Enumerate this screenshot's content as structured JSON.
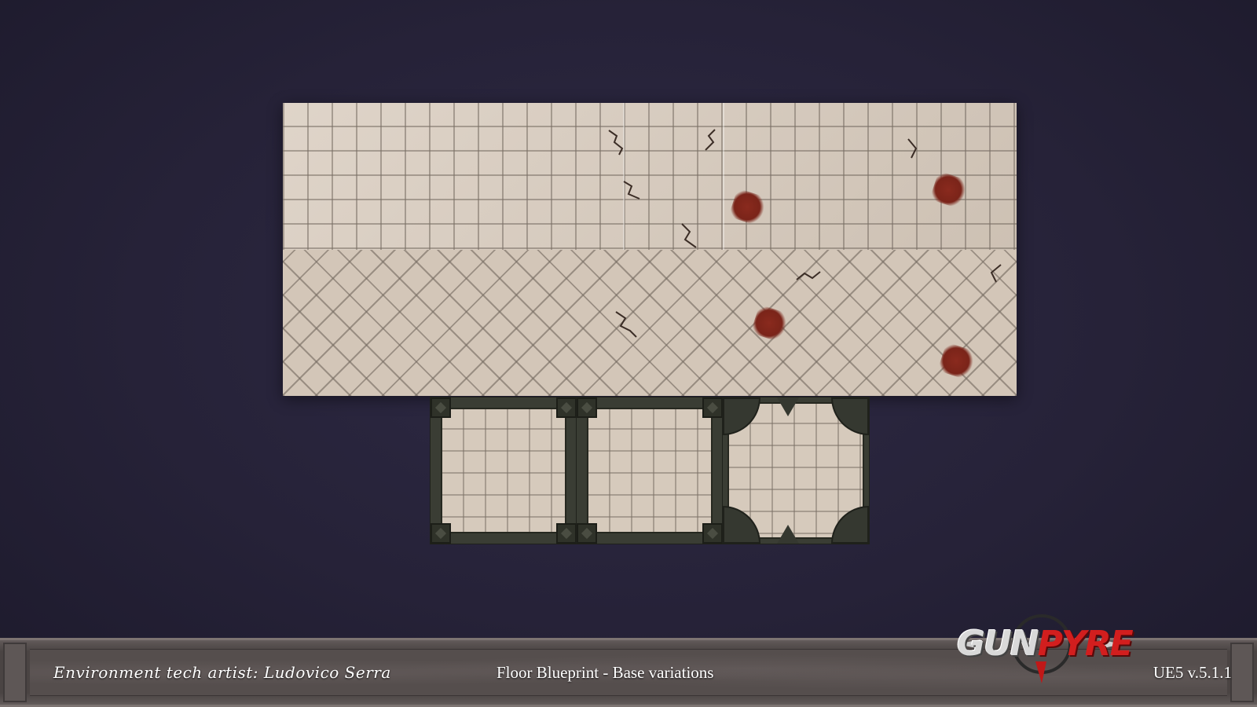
{
  "footer": {
    "credit": "Environment tech artist: Ludovico Serra",
    "caption": "Floor Blueprint - Base variations",
    "version": "UE5 v.5.1.1"
  },
  "logo": {
    "part1": "GUN",
    "part2": "PYRE",
    "accent_color": "#d21e1e"
  },
  "colors": {
    "background": "#262238",
    "tile": "#d8cbbd",
    "frame": "#3a3d34",
    "blood": "#8a2a1e"
  },
  "viewport": {
    "floor_panel": "floor-tile-preview",
    "framed_tiles": [
      "frame-tile-square-corners",
      "frame-tile-square-corners-alt",
      "frame-tile-ornate"
    ]
  }
}
